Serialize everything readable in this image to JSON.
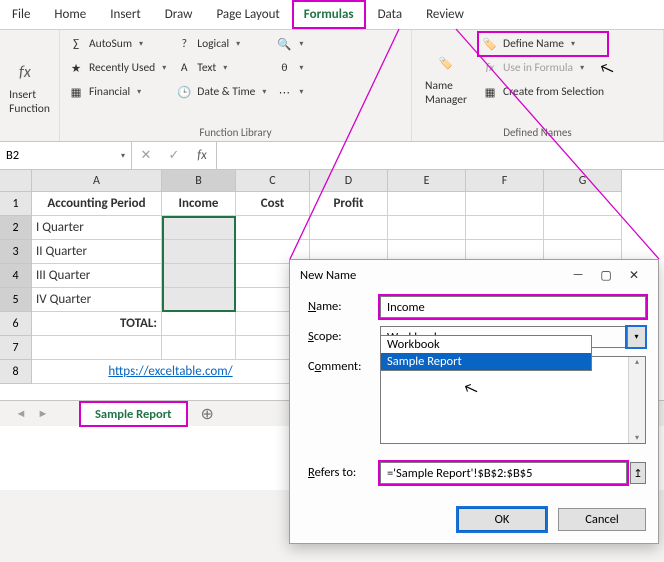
{
  "tabs": {
    "file": "File",
    "home": "Home",
    "insert": "Insert",
    "draw": "Draw",
    "page_layout": "Page Layout",
    "formulas": "Formulas",
    "data": "Data",
    "review": "Review"
  },
  "ribbon": {
    "insert_fn": "Insert\nFunction",
    "autosum": "AutoSum",
    "recent": "Recently Used",
    "financial": "Financial",
    "logical": "Logical",
    "text": "Text",
    "datetime": "Date & Time",
    "group_fnlib": "Function Library",
    "name_mgr": "Name\nManager",
    "define_name": "Define Name",
    "use_formula": "Use in Formula",
    "create_sel": "Create from Selection",
    "group_names": "Defined Names"
  },
  "namebox": "B2",
  "columns": {
    "a": "A",
    "b": "B",
    "c": "C",
    "d": "D",
    "e": "E",
    "f": "F",
    "g": "G"
  },
  "rows": {
    "r1": "1",
    "r2": "2",
    "r3": "3",
    "r4": "4",
    "r5": "5",
    "r6": "6",
    "r7": "7",
    "r8": "8"
  },
  "data": {
    "a1": "Accounting Period",
    "b1": "Income",
    "c1": "Cost",
    "d1": "Profit",
    "a2": "I Quarter",
    "a3": "II Quarter",
    "a4": "III Quarter",
    "a5": "IV Quarter",
    "a6": "TOTAL:",
    "a8": "https://exceltable.com/"
  },
  "sheet_tab": "Sample Report",
  "dialog": {
    "title": "New Name",
    "label_name": "Name:",
    "label_scope": "Scope:",
    "label_comment": "Comment:",
    "label_refers": "Refers to:",
    "name_val": "Income",
    "scope_val": "Workbook",
    "scope_opts": [
      "Workbook",
      "Sample Report"
    ],
    "refers_val": "='Sample Report'!$B$2:$B$5",
    "ok": "OK",
    "cancel": "Cancel"
  }
}
